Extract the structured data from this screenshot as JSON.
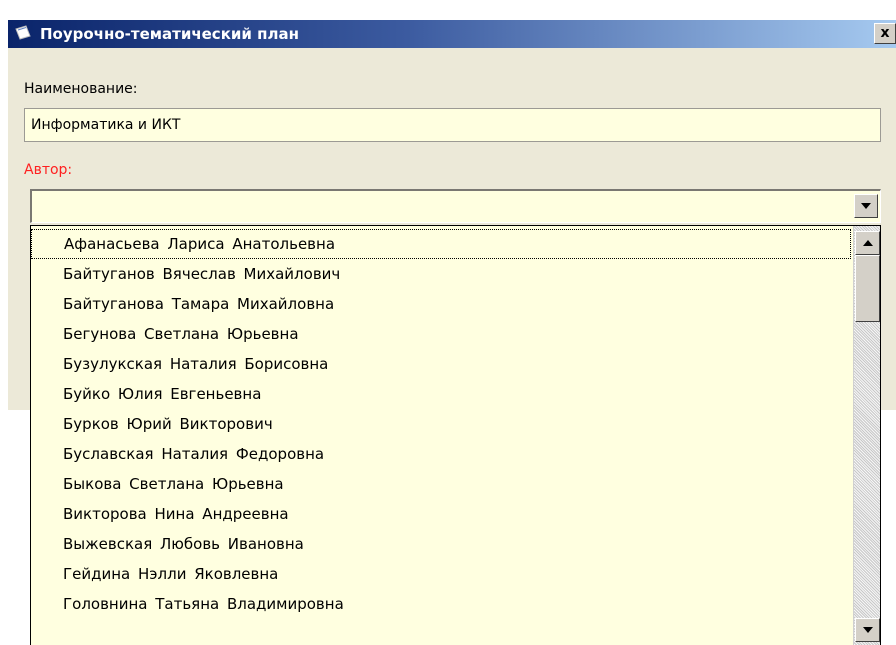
{
  "window": {
    "title": "Поурочно-тематический план",
    "close_label": "x"
  },
  "form": {
    "name_label": "Наименование:",
    "name_value": "Информатика и ИКТ",
    "author_label": "Автор:",
    "author_value": ""
  },
  "author_list": {
    "items": [
      "Афанасьева Лариса Анатольевна",
      "Байтуганов Вячеслав Михайлович",
      "Байтуганова Тамара Михайловна",
      "Бегунова Светлана Юрьевна",
      "Бузулукская Наталия Борисовна",
      "Буйко Юлия Евгеньевна",
      "Бурков Юрий Викторович",
      "Буславская Наталия Федоровна",
      "Быкова Светлана Юрьевна",
      "Викторова Нина Андреевна",
      "Выжевская Любовь Ивановна",
      "Гейдина Нэлли Яковлевна",
      "Головнина Татьяна Владимировна"
    ],
    "focused_index": 0
  },
  "colors": {
    "title_gradient_start": "#0a246a",
    "title_gradient_end": "#a6caf0",
    "required_label": "#ff2020",
    "field_background": "#ffffe0",
    "window_background": "#ece9d8"
  }
}
